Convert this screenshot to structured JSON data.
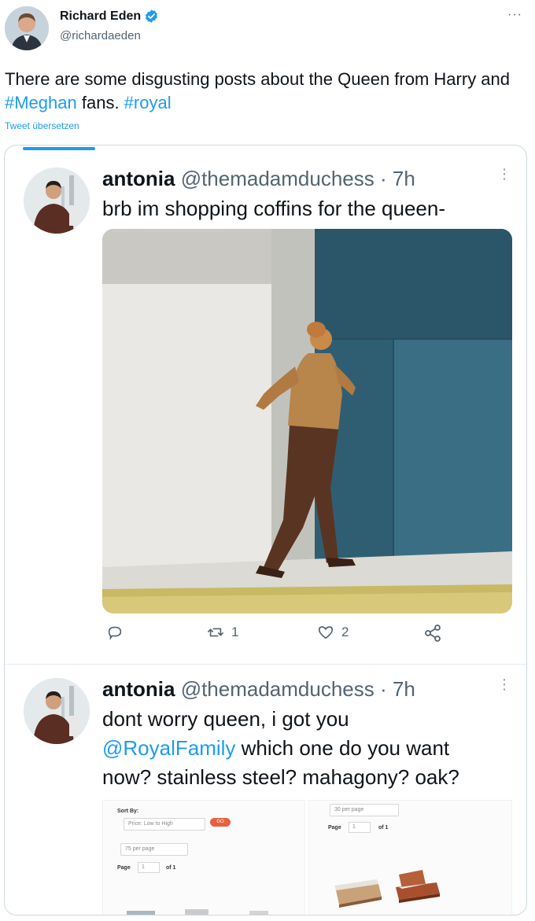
{
  "author": {
    "name": "Richard Eden",
    "handle": "@richardaeden",
    "verified_icon": "verified-badge-icon",
    "more_icon": "more-icon",
    "more_label": "···"
  },
  "tweet": {
    "text_parts": [
      {
        "text": "There are some disgusting posts about the Queen from Harry and ",
        "type": "text"
      },
      {
        "text": "#Meghan",
        "type": "link"
      },
      {
        "text": " fans. ",
        "type": "text"
      },
      {
        "text": "#royal",
        "type": "link"
      }
    ],
    "translate_label": "Tweet übersetzen"
  },
  "quoted": {
    "replies": [
      {
        "name": "antonia",
        "meta": "@themadamduchess · 7h",
        "text": "brb im shopping coffins for the queen-",
        "actions": {
          "reply_icon": "reply-icon",
          "retweet_icon": "retweet-icon",
          "retweet_count": "1",
          "like_icon": "heart-icon",
          "like_count": "2",
          "share_icon": "share-icon"
        }
      },
      {
        "name": "antonia",
        "meta": "@themadamduchess · 7h",
        "line1": "dont worry queen, i got you",
        "mention": "@RoyalFamily",
        "line2_rest": " which one do you want",
        "line3": "now? stainless steel? mahagony? oak?"
      }
    ],
    "shop": {
      "sort_label": "Sort By:",
      "sort_value": "Price: Low to High",
      "go_label": "GO",
      "per_page_left": "75 per page",
      "per_page_right": "30 per page",
      "page_label": "Page",
      "page_value": "1",
      "of_label": "of 1"
    }
  },
  "colors": {
    "link": "#1d9bf0",
    "muted": "#536471",
    "text": "#0f1419",
    "border": "#cfd9de"
  }
}
